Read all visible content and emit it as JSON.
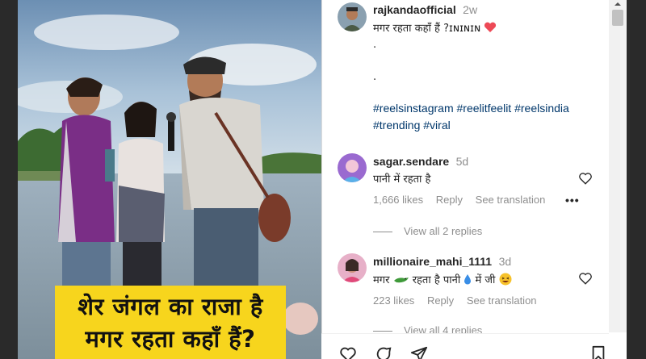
{
  "post": {
    "author": "rajkandaofficial",
    "time": "2w",
    "caption_line1": "मगर रहता कहाँ हैं ?ɪɴɪɴɪɴ",
    "dot1": ".",
    "dot2": ".",
    "hashtags_line1": "#reelsinstagram #reelitfeelit #reelsindia",
    "hashtags_line2": "#trending #viral"
  },
  "video_caption": {
    "line1": "शेर जंगल का राजा है",
    "line2": "मगर रहता कहाँ हैं?"
  },
  "comments": [
    {
      "username": "sagar.sendare",
      "time": "5d",
      "text": "पानी में रहता है",
      "likes": "1,666 likes",
      "reply": "Reply",
      "translate": "See translation",
      "more": "•••",
      "view_replies": "View all 2 replies"
    },
    {
      "username": "millionaire_mahi_1111",
      "time": "3d",
      "text_a": "मगर",
      "text_b": " रहता है पानी",
      "text_c": " में जी ",
      "likes": "223 likes",
      "reply": "Reply",
      "translate": "See translation",
      "view_replies": "View all 4 replies"
    }
  ],
  "icons": {
    "like": "heart-icon",
    "comment": "comment-icon",
    "share": "share-icon",
    "save": "bookmark-icon"
  },
  "colors": {
    "caption_bg": "#f7d51d",
    "hashtag": "#00376b",
    "heart_red": "#ed4956",
    "meta_gray": "#8e8e8e"
  }
}
